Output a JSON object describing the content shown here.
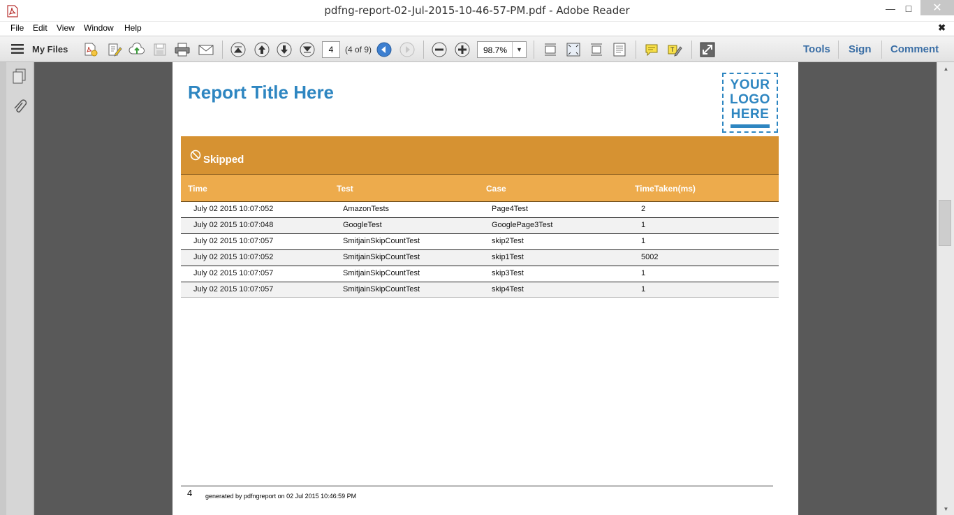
{
  "window": {
    "title": "pdfng-report-02-Jul-2015-10-46-57-PM.pdf - Adobe Reader",
    "minimize_glyph": "—",
    "maximize_glyph": "□",
    "close_glyph": "✕"
  },
  "menu": {
    "items": [
      "File",
      "Edit",
      "View",
      "Window",
      "Help"
    ],
    "close_glyph": "✖"
  },
  "toolbar": {
    "my_files": "My Files",
    "page_number": "4",
    "page_of": "(4 of 9)",
    "zoom": "98.7%",
    "tools": "Tools",
    "sign": "Sign",
    "comment": "Comment"
  },
  "report": {
    "title": "Report Title Here",
    "logo_lines": [
      "YOUR",
      "LOGO",
      "HERE"
    ],
    "section": "Skipped",
    "accent_color": "#d69232",
    "header_color": "#edab4c",
    "title_color": "#2e86c1",
    "columns": [
      "Time",
      "Test",
      "Case",
      "TimeTaken(ms)"
    ],
    "rows": [
      [
        "July 02 2015 10:07:052",
        "AmazonTests",
        "Page4Test",
        "2"
      ],
      [
        "July 02 2015 10:07:048",
        "GoogleTest",
        "GooglePage3Test",
        "1"
      ],
      [
        "July 02 2015 10:07:057",
        "SmitjainSkipCountTest",
        "skip2Test",
        "1"
      ],
      [
        "July 02 2015 10:07:052",
        "SmitjainSkipCountTest",
        "skip1Test",
        "5002"
      ],
      [
        "July 02 2015 10:07:057",
        "SmitjainSkipCountTest",
        "skip3Test",
        "1"
      ],
      [
        "July 02 2015 10:07:057",
        "SmitjainSkipCountTest",
        "skip4Test",
        "1"
      ]
    ],
    "footer_page": "4",
    "footer_text": "generated by pdfngreport  on 02 Jul 2015 10:46:59 PM"
  }
}
